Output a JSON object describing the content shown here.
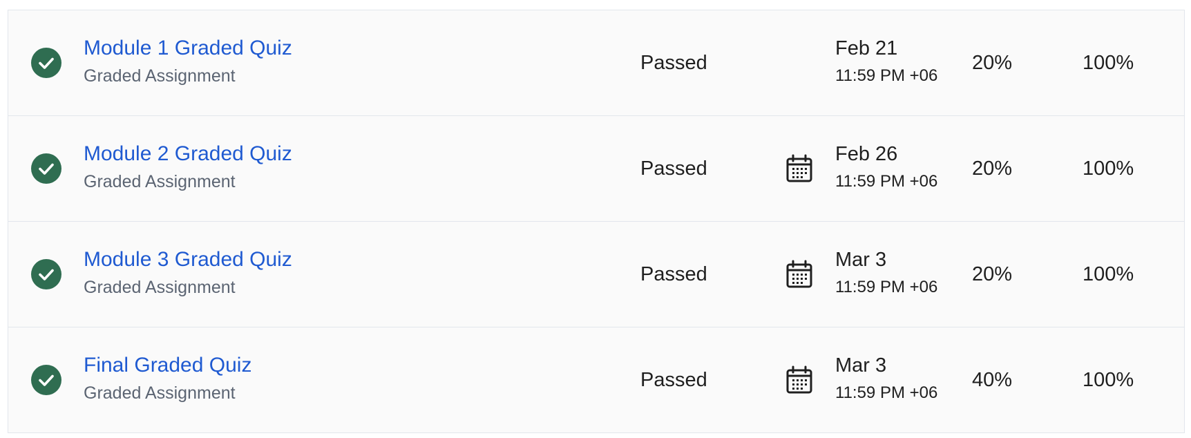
{
  "colors": {
    "check_bg": "#2f6d51",
    "link": "#1f5ad1",
    "subtext": "#5b6472",
    "text": "#1f1f1f",
    "border": "#e2e6ec",
    "row_bg": "#fafafa"
  },
  "assignments": [
    {
      "status_icon": "check-circle-icon",
      "title": "Module 1 Graded Quiz",
      "type": "Graded Assignment",
      "status": "Passed",
      "show_calendar_icon": false,
      "due_date": "Feb 21",
      "due_time": "11:59 PM +06",
      "weight": "20%",
      "grade": "100%"
    },
    {
      "status_icon": "check-circle-icon",
      "title": "Module 2 Graded Quiz",
      "type": "Graded Assignment",
      "status": "Passed",
      "show_calendar_icon": true,
      "due_date": "Feb 26",
      "due_time": "11:59 PM +06",
      "weight": "20%",
      "grade": "100%"
    },
    {
      "status_icon": "check-circle-icon",
      "title": "Module 3 Graded Quiz",
      "type": "Graded Assignment",
      "status": "Passed",
      "show_calendar_icon": true,
      "due_date": "Mar 3",
      "due_time": "11:59 PM +06",
      "weight": "20%",
      "grade": "100%"
    },
    {
      "status_icon": "check-circle-icon",
      "title": "Final Graded Quiz",
      "type": "Graded Assignment",
      "status": "Passed",
      "show_calendar_icon": true,
      "due_date": "Mar 3",
      "due_time": "11:59 PM +06",
      "weight": "40%",
      "grade": "100%"
    }
  ]
}
